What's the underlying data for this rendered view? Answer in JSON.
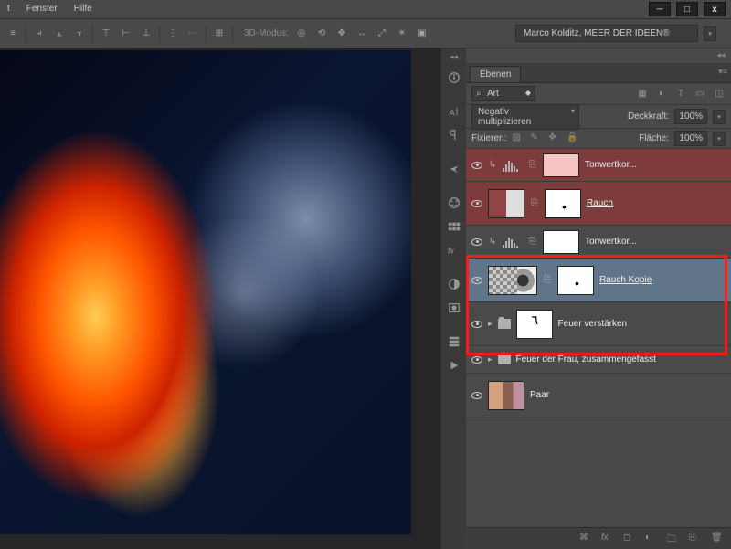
{
  "menu": {
    "t": "t",
    "fenster": "Fenster",
    "hilfe": "Hilfe"
  },
  "window": {
    "min": "─",
    "max": "□",
    "close": "x"
  },
  "toolbar": {
    "mode3d": "3D-Modus:",
    "user": "Marco Kolditz, MEER DER IDEEN®"
  },
  "panel": {
    "tab": "Ebenen",
    "search": {
      "label": "Art"
    },
    "blend": {
      "mode": "Negativ multiplizieren",
      "opacity_label": "Deckkraft:",
      "opacity": "100%"
    },
    "lock": {
      "label": "Fixieren:",
      "fill_label": "Fläche:",
      "fill": "100%"
    }
  },
  "layers": {
    "clip": "↳",
    "l1": "Tonwertkor...",
    "l2": "Rauch",
    "l3": "Tonwertkor...",
    "l4": "Rauch Kopie",
    "l5": "Feuer verstärken",
    "l6": "Feuer der Frau, zusammengefasst",
    "l7": "Paar"
  }
}
